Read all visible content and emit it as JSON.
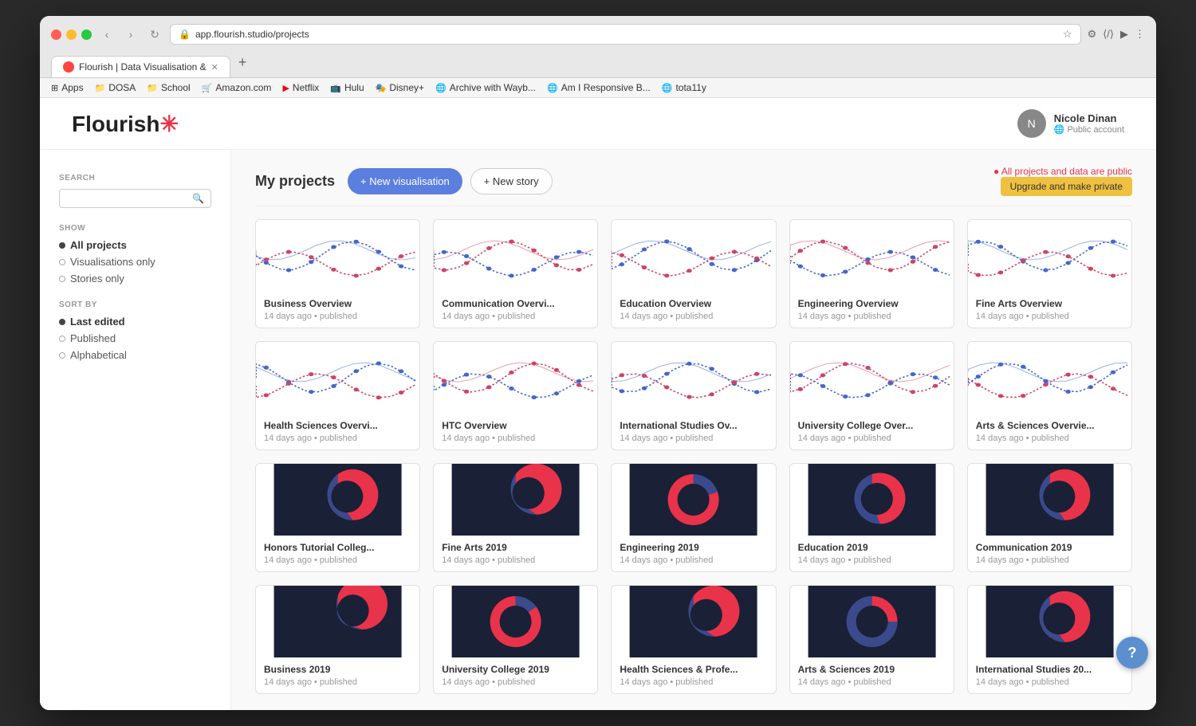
{
  "browser": {
    "url": "app.flourish.studio/projects",
    "tab_title": "Flourish | Data Visualisation &",
    "bookmarks": [
      {
        "label": "Apps",
        "icon": "⊞"
      },
      {
        "label": "DOSA",
        "icon": "📁"
      },
      {
        "label": "School",
        "icon": "📁"
      },
      {
        "label": "Amazon.com",
        "icon": "🛒"
      },
      {
        "label": "Netflix",
        "icon": "🎬"
      },
      {
        "label": "Hulu",
        "icon": "📺"
      },
      {
        "label": "Disney+",
        "icon": "🎭"
      },
      {
        "label": "Archive with Wayb...",
        "icon": "🌐"
      },
      {
        "label": "Am I Responsive B...",
        "icon": "🌐"
      },
      {
        "label": "tota11y",
        "icon": "🌐"
      }
    ]
  },
  "app": {
    "logo": "Flourish",
    "logo_asterisk": "✳",
    "user_name": "Nicole Dinan",
    "user_type": "Public account"
  },
  "top_bar": {
    "title": "My projects",
    "new_vis_label": "+ New visualisation",
    "new_story_label": "+ New story",
    "public_notice": "All projects and data are public",
    "upgrade_label": "Upgrade and make private"
  },
  "sidebar": {
    "search_label": "SEARCH",
    "search_placeholder": "",
    "show_label": "SHOW",
    "show_options": [
      {
        "label": "All projects",
        "active": true
      },
      {
        "label": "Visualisations only",
        "active": false
      },
      {
        "label": "Stories only",
        "active": false
      }
    ],
    "sort_label": "SORT BY",
    "sort_options": [
      {
        "label": "Last edited",
        "active": true
      },
      {
        "label": "Published",
        "active": false
      },
      {
        "label": "Alphabetical",
        "active": false
      }
    ]
  },
  "projects": [
    {
      "title": "Business Overview",
      "meta": "14 days ago • published",
      "type": "line"
    },
    {
      "title": "Communication Overvi...",
      "meta": "14 days ago • published",
      "type": "line"
    },
    {
      "title": "Education Overview",
      "meta": "14 days ago • published",
      "type": "line"
    },
    {
      "title": "Engineering Overview",
      "meta": "14 days ago • published",
      "type": "line"
    },
    {
      "title": "Fine Arts Overview",
      "meta": "14 days ago • published",
      "type": "line"
    },
    {
      "title": "Health Sciences Overvi...",
      "meta": "14 days ago • published",
      "type": "line"
    },
    {
      "title": "HTC Overview",
      "meta": "14 days ago • published",
      "type": "line"
    },
    {
      "title": "International Studies Ov...",
      "meta": "14 days ago • published",
      "type": "line"
    },
    {
      "title": "University College Over...",
      "meta": "14 days ago • published",
      "type": "line"
    },
    {
      "title": "Arts & Sciences Overvie...",
      "meta": "14 days ago • published",
      "type": "line"
    },
    {
      "title": "Honors Tutorial Colleg...",
      "meta": "14 days ago • published",
      "type": "donut"
    },
    {
      "title": "Fine Arts 2019",
      "meta": "14 days ago • published",
      "type": "donut"
    },
    {
      "title": "Engineering 2019",
      "meta": "14 days ago • published",
      "type": "donut"
    },
    {
      "title": "Education 2019",
      "meta": "14 days ago • published",
      "type": "donut"
    },
    {
      "title": "Communication 2019",
      "meta": "14 days ago • published",
      "type": "donut"
    },
    {
      "title": "Business 2019",
      "meta": "14 days ago • published",
      "type": "donut"
    },
    {
      "title": "University College 2019",
      "meta": "14 days ago • published",
      "type": "donut"
    },
    {
      "title": "Health Sciences & Profe...",
      "meta": "14 days ago • published",
      "type": "donut"
    },
    {
      "title": "Arts & Sciences 2019",
      "meta": "14 days ago • published",
      "type": "donut"
    },
    {
      "title": "International Studies 20...",
      "meta": "14 days ago • published",
      "type": "donut"
    }
  ],
  "help_btn": "?"
}
